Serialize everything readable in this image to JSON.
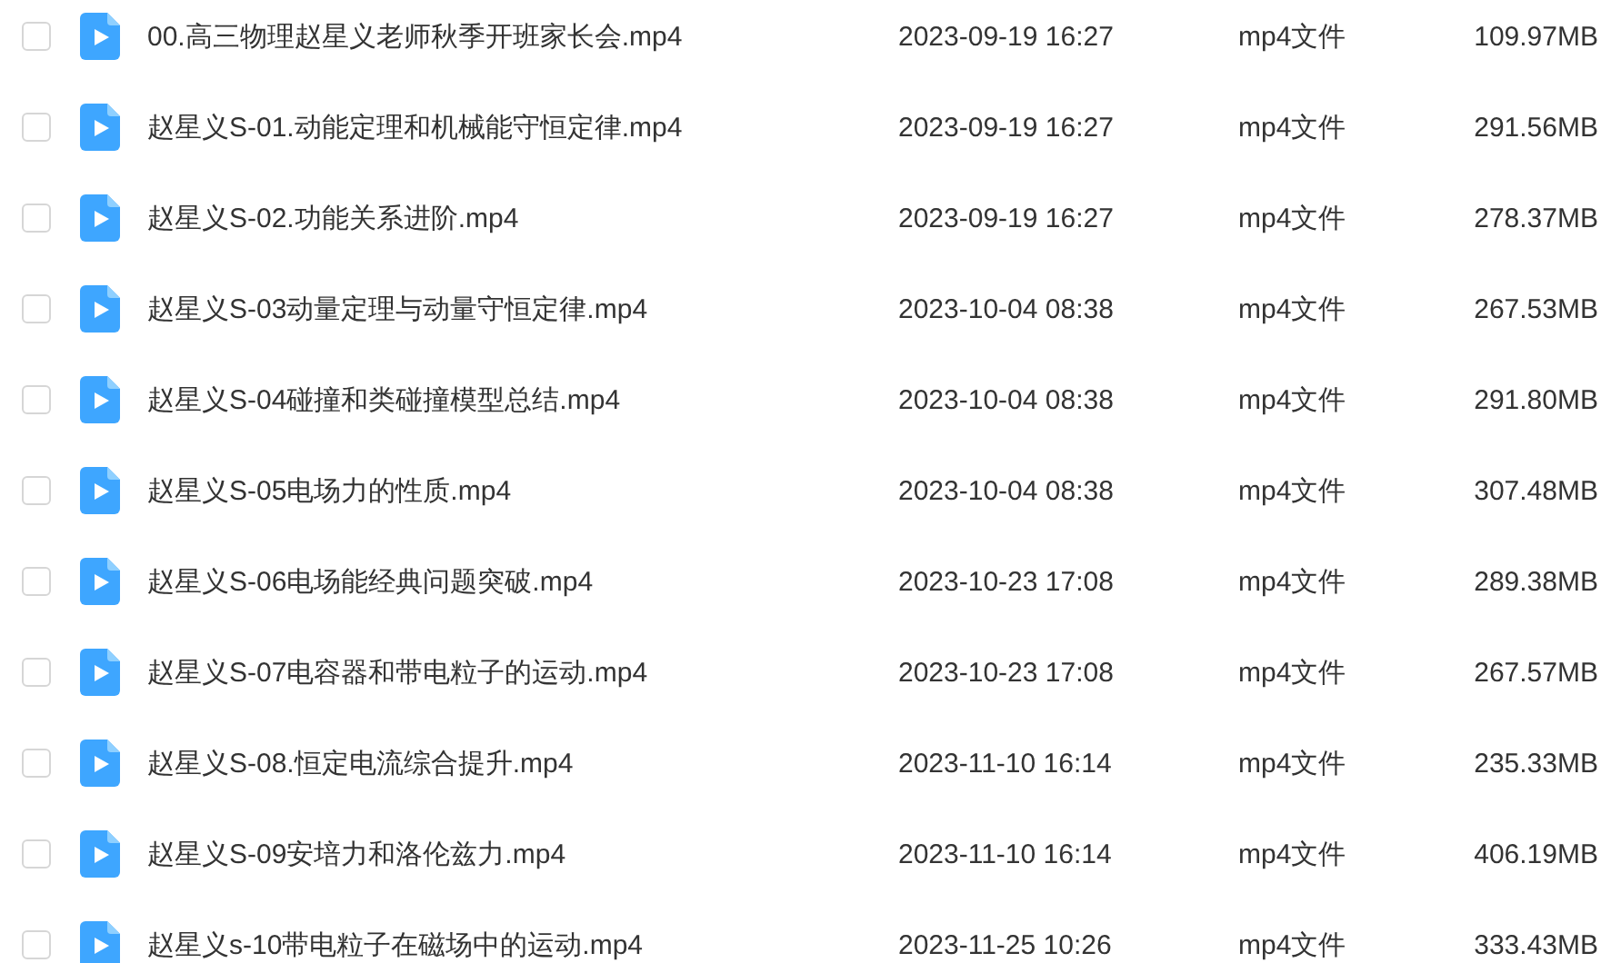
{
  "files": [
    {
      "name": "00.高三物理赵星义老师秋季开班家长会.mp4",
      "modified": "2023-09-19 16:27",
      "type": "mp4文件",
      "size": "109.97MB",
      "selected": false
    },
    {
      "name": "赵星义S-01.动能定理和机械能守恒定律.mp4",
      "modified": "2023-09-19 16:27",
      "type": "mp4文件",
      "size": "291.56MB",
      "selected": false
    },
    {
      "name": "赵星义S-02.功能关系进阶.mp4",
      "modified": "2023-09-19 16:27",
      "type": "mp4文件",
      "size": "278.37MB",
      "selected": false
    },
    {
      "name": "赵星义S-03动量定理与动量守恒定律.mp4",
      "modified": "2023-10-04 08:38",
      "type": "mp4文件",
      "size": "267.53MB",
      "selected": false
    },
    {
      "name": "赵星义S-04碰撞和类碰撞模型总结.mp4",
      "modified": "2023-10-04 08:38",
      "type": "mp4文件",
      "size": "291.80MB",
      "selected": false
    },
    {
      "name": "赵星义S-05电场力的性质.mp4",
      "modified": "2023-10-04 08:38",
      "type": "mp4文件",
      "size": "307.48MB",
      "selected": false
    },
    {
      "name": "赵星义S-06电场能经典问题突破.mp4",
      "modified": "2023-10-23 17:08",
      "type": "mp4文件",
      "size": "289.38MB",
      "selected": false
    },
    {
      "name": "赵星义S-07电容器和带电粒子的运动.mp4",
      "modified": "2023-10-23 17:08",
      "type": "mp4文件",
      "size": "267.57MB",
      "selected": false
    },
    {
      "name": "赵星义S-08.恒定电流综合提升.mp4",
      "modified": "2023-11-10 16:14",
      "type": "mp4文件",
      "size": "235.33MB",
      "selected": false
    },
    {
      "name": "赵星义S-09安培力和洛伦兹力.mp4",
      "modified": "2023-11-10 16:14",
      "type": "mp4文件",
      "size": "406.19MB",
      "selected": false
    },
    {
      "name": "赵星义s-10带电粒子在磁场中的运动.mp4",
      "modified": "2023-11-25 10:26",
      "type": "mp4文件",
      "size": "333.43MB",
      "selected": false
    }
  ]
}
